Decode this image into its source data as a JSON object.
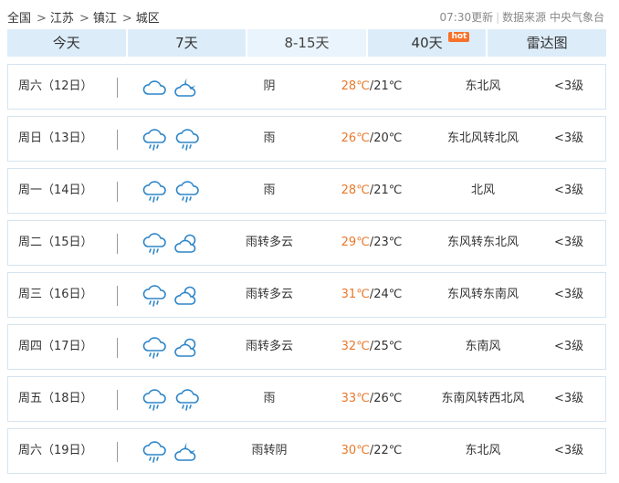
{
  "breadcrumb": [
    "全国",
    "江苏",
    "镇江",
    "城区"
  ],
  "breadcrumb_sep": ">",
  "update_text": "07:30更新",
  "source_text": "数据来源 中央气象台",
  "tabs": [
    {
      "label": "今天",
      "active": false
    },
    {
      "label": "7天",
      "active": false
    },
    {
      "label": "8-15天",
      "active": true
    },
    {
      "label": "40天",
      "active": false,
      "badge": "hot"
    },
    {
      "label": "雷达图",
      "active": false
    }
  ],
  "days": [
    {
      "date": "周六（12日）",
      "icons": [
        "cloudy-icon",
        "cloudy-night-icon"
      ],
      "condition": "阴",
      "high": "28℃",
      "low": "/21℃",
      "wind": "东北风",
      "level": "<3级"
    },
    {
      "date": "周日（13日）",
      "icons": [
        "rain-icon",
        "rain-icon"
      ],
      "condition": "雨",
      "high": "26℃",
      "low": "/20℃",
      "wind": "东北风转北风",
      "level": "<3级"
    },
    {
      "date": "周一（14日）",
      "icons": [
        "rain-icon",
        "rain-icon"
      ],
      "condition": "雨",
      "high": "28℃",
      "low": "/21℃",
      "wind": "北风",
      "level": "<3级"
    },
    {
      "date": "周二（15日）",
      "icons": [
        "rain-icon",
        "partly-cloudy-icon"
      ],
      "condition": "雨转多云",
      "high": "29℃",
      "low": "/23℃",
      "wind": "东风转东北风",
      "level": "<3级"
    },
    {
      "date": "周三（16日）",
      "icons": [
        "rain-icon",
        "partly-cloudy-icon"
      ],
      "condition": "雨转多云",
      "high": "31℃",
      "low": "/24℃",
      "wind": "东风转东南风",
      "level": "<3级"
    },
    {
      "date": "周四（17日）",
      "icons": [
        "rain-icon",
        "partly-cloudy-icon"
      ],
      "condition": "雨转多云",
      "high": "32℃",
      "low": "/25℃",
      "wind": "东南风",
      "level": "<3级"
    },
    {
      "date": "周五（18日）",
      "icons": [
        "rain-icon",
        "rain-icon"
      ],
      "condition": "雨",
      "high": "33℃",
      "low": "/26℃",
      "wind": "东南风转西北风",
      "level": "<3级"
    },
    {
      "date": "周六（19日）",
      "icons": [
        "rain-icon",
        "cloudy-night-icon"
      ],
      "condition": "雨转阴",
      "high": "30℃",
      "low": "/22℃",
      "wind": "东北风",
      "level": "<3级"
    }
  ]
}
